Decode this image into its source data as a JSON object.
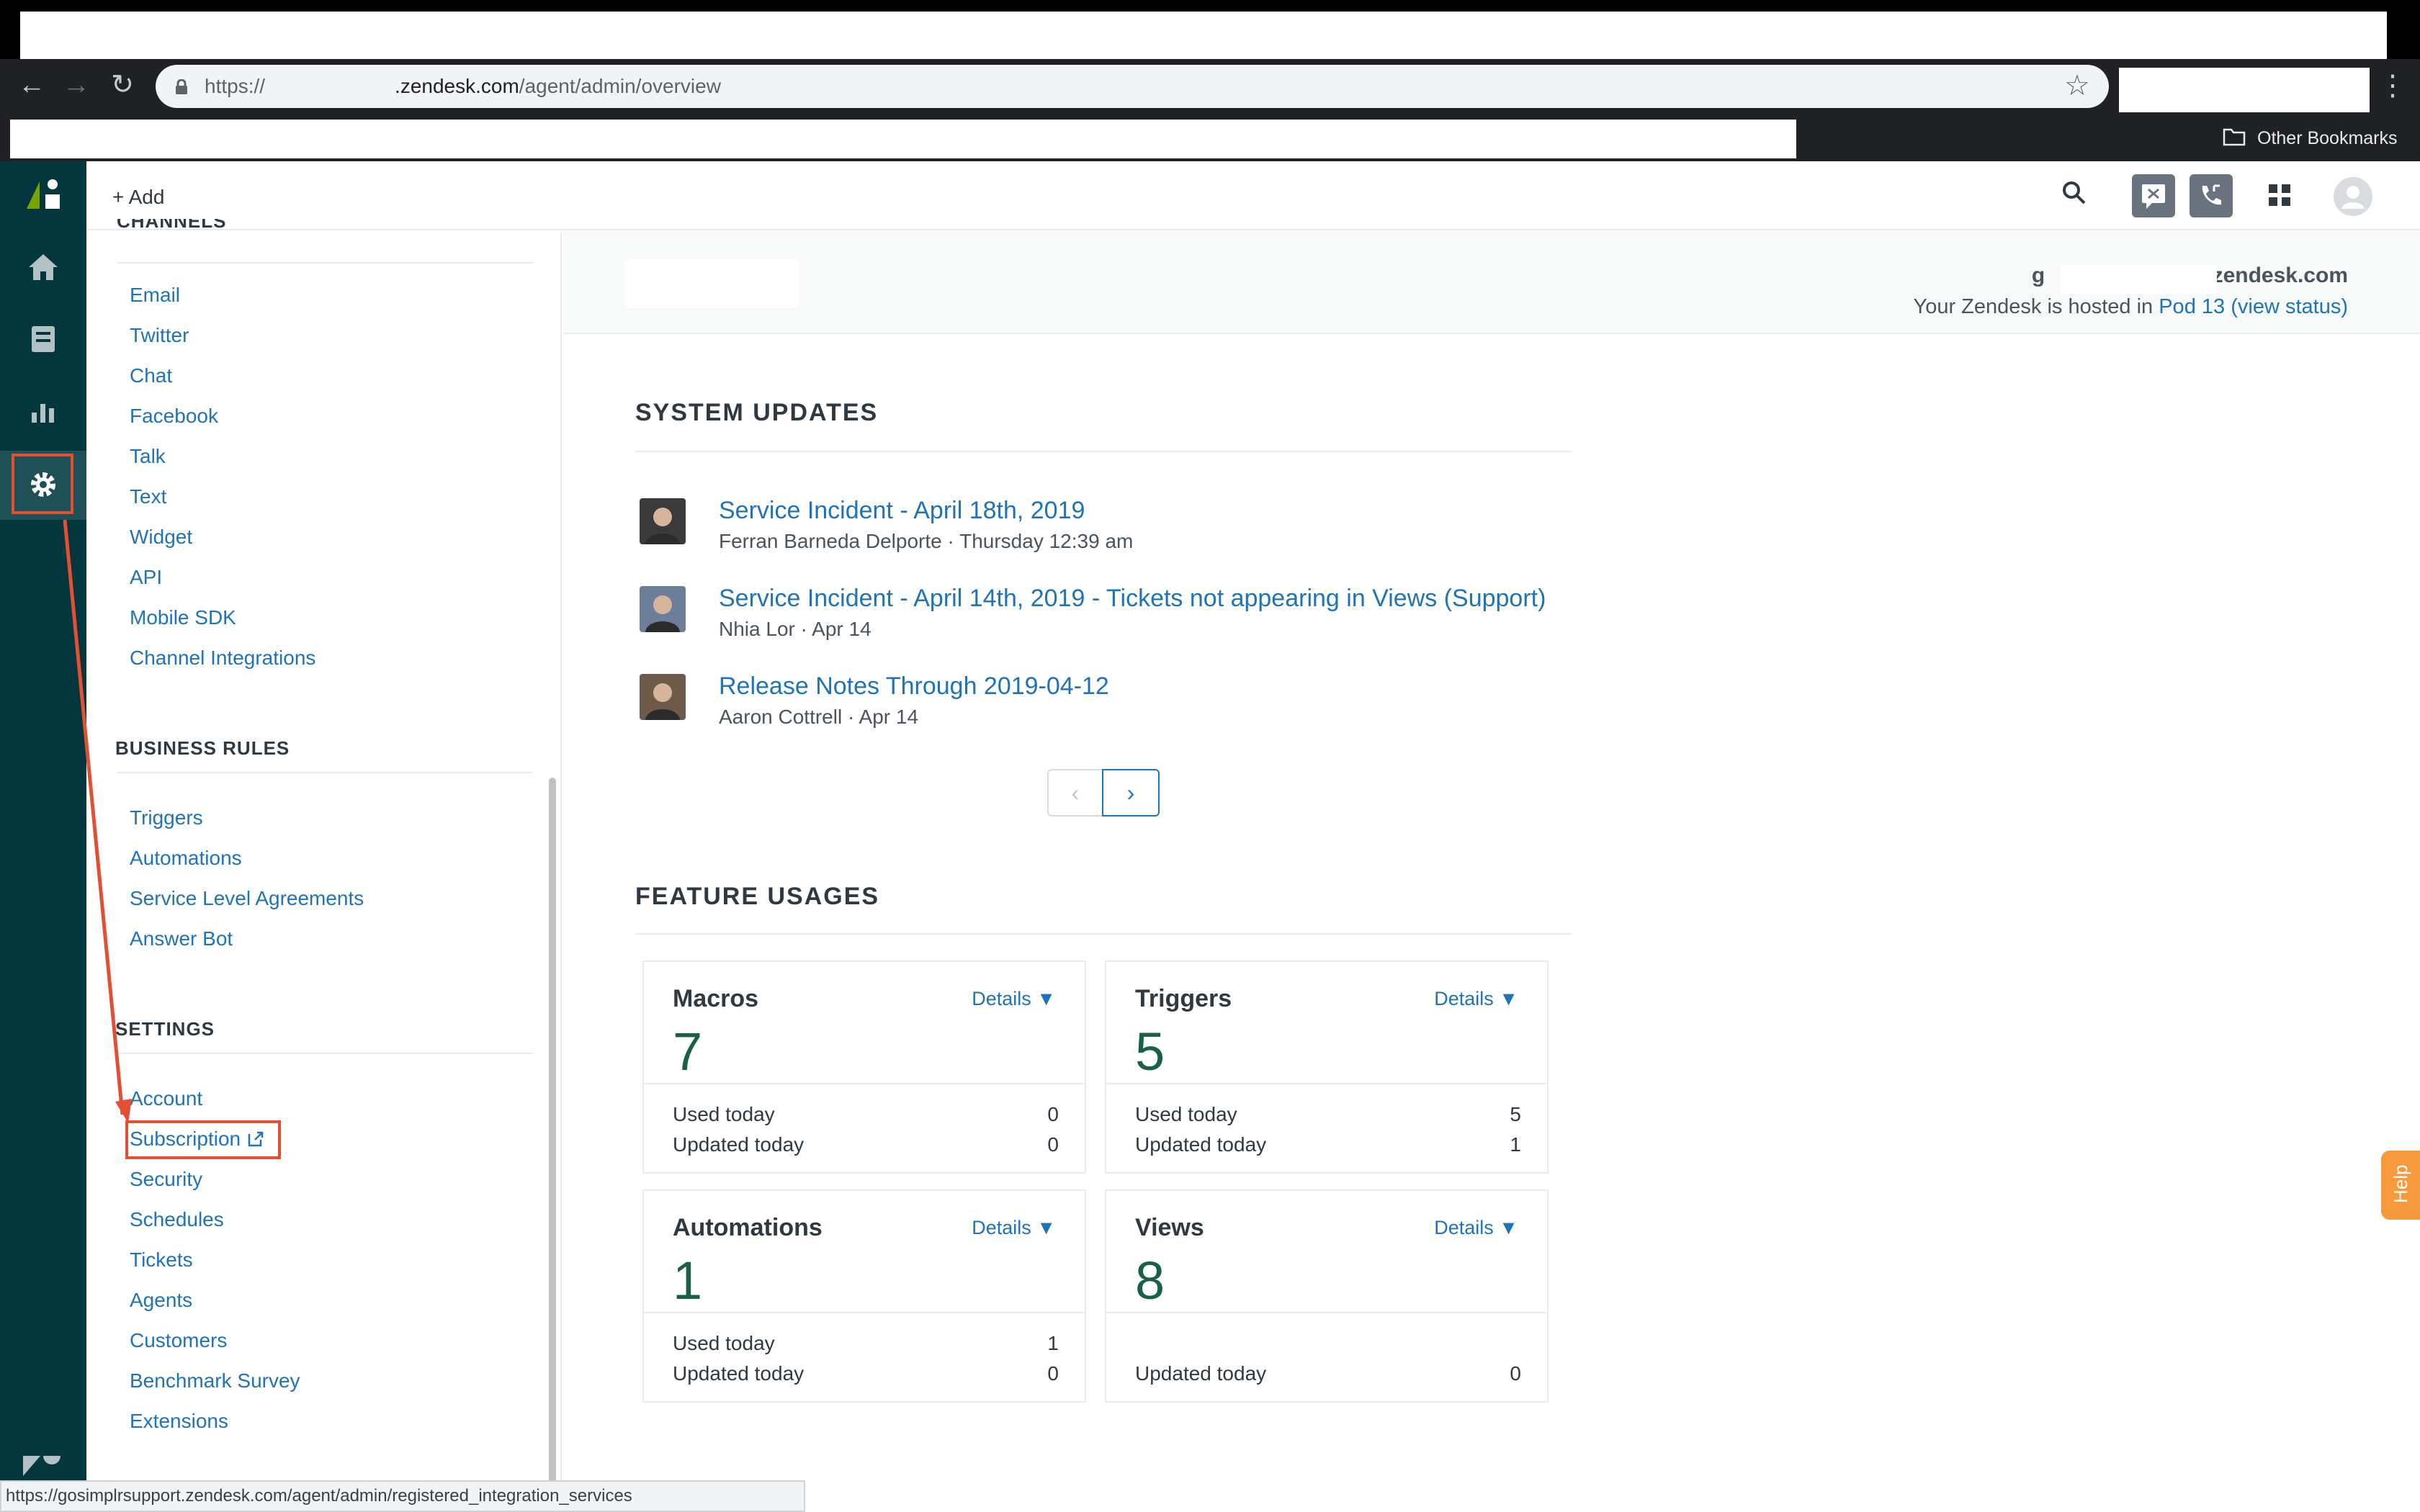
{
  "browser": {
    "url_prefix": "https://",
    "url_domain": ".zendesk.com",
    "url_path": "/agent/admin/overview",
    "other_bookmarks": "Other Bookmarks",
    "status_url": "https://gosimplrsupport.zendesk.com/agent/admin/registered_integration_services"
  },
  "topbar": {
    "add_label": "+ Add"
  },
  "sidebar": {
    "channels": [
      "Email",
      "Twitter",
      "Chat",
      "Facebook",
      "Talk",
      "Text",
      "Widget",
      "API",
      "Mobile SDK",
      "Channel Integrations"
    ],
    "business_rules": {
      "heading": "BUSINESS RULES",
      "items": [
        "Triggers",
        "Automations",
        "Service Level Agreements",
        "Answer Bot"
      ]
    },
    "settings": {
      "heading": "SETTINGS",
      "items": [
        "Account",
        "Subscription",
        "Security",
        "Schedules",
        "Tickets",
        "Agents",
        "Customers",
        "Benchmark Survey",
        "Extensions"
      ]
    }
  },
  "account": {
    "domain_prefix": "g",
    "domain_suffix": ".zendesk.com",
    "host_prefix": "Your Zendesk is hosted in ",
    "pod": "Pod 13",
    "view_status": "view status"
  },
  "system_updates": {
    "heading": "SYSTEM UPDATES",
    "items": [
      {
        "title": "Service Incident - April 18th, 2019",
        "meta": "Ferran Barneda Delporte · Thursday 12:39 am"
      },
      {
        "title": "Service Incident - April 14th, 2019 - Tickets not appearing in Views (Support)",
        "meta": "Nhia Lor · Apr 14"
      },
      {
        "title": "Release Notes Through 2019-04-12",
        "meta": "Aaron Cottrell · Apr 14"
      }
    ],
    "pager_prev": "‹",
    "pager_next": "›"
  },
  "feature_usages": {
    "heading": "FEATURE USAGES",
    "details_label": "Details ▼",
    "used_label": "Used today",
    "updated_label": "Updated today",
    "cards": [
      {
        "title": "Macros",
        "count": "7",
        "used": "0",
        "updated": "0"
      },
      {
        "title": "Triggers",
        "count": "5",
        "used": "5",
        "updated": "1"
      },
      {
        "title": "Automations",
        "count": "1",
        "used": "1",
        "updated": "0"
      },
      {
        "title": "Views",
        "count": "8",
        "used": "",
        "updated": "0"
      }
    ]
  },
  "help_label": "Help",
  "colors": {
    "rail": "#03363d",
    "link": "#1f73b7",
    "accent_green": "#186146",
    "annotation_red": "#e34f32",
    "help_orange": "#f79a3e"
  }
}
